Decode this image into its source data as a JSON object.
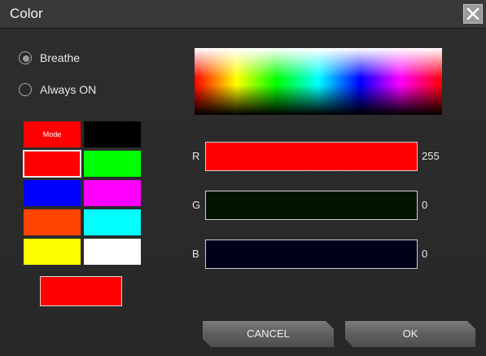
{
  "window": {
    "title": "Color"
  },
  "effect_modes": [
    {
      "label": "Breathe",
      "selected": true
    },
    {
      "label": "Always ON",
      "selected": false
    }
  ],
  "palette": {
    "mode_label": "Mode",
    "swatches": [
      "#ff0000",
      "#000000",
      "#ff0000",
      "#00ff00",
      "#0000ff",
      "#ff00ff",
      "#ff4500",
      "#00ffff",
      "#ffff00",
      "#ffffff"
    ],
    "selected_index": 2
  },
  "preview": {
    "color": "#ff0000"
  },
  "channels": [
    {
      "name": "R",
      "value": "255",
      "color": "#ff0000"
    },
    {
      "name": "G",
      "value": "0",
      "color": "#001400"
    },
    {
      "name": "B",
      "value": "0",
      "color": "#00001a"
    }
  ],
  "buttons": {
    "cancel": "CANCEL",
    "ok": "OK"
  }
}
